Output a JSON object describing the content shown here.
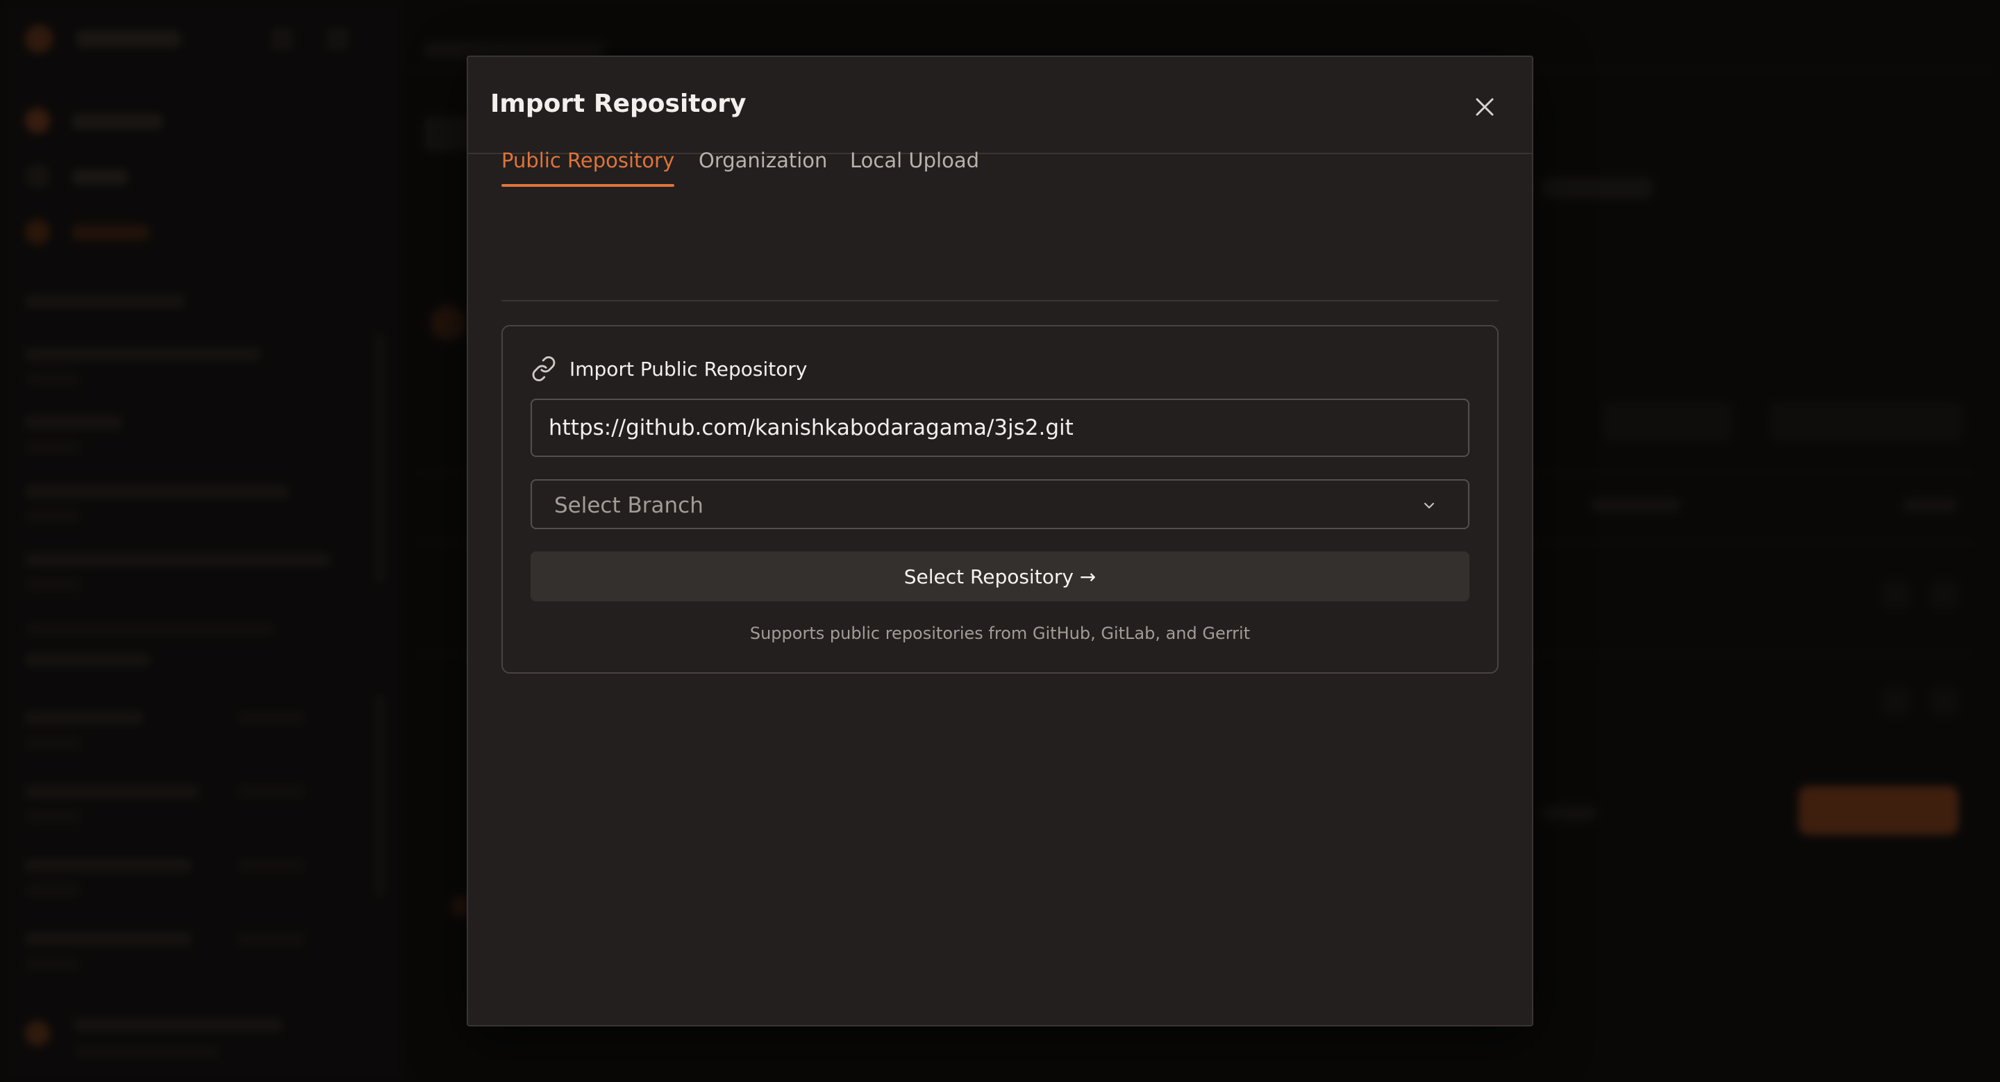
{
  "modal": {
    "title": "Import Repository",
    "close_icon": "close-icon"
  },
  "tabs": [
    {
      "label": "Public Repository",
      "active": true
    },
    {
      "label": "Organization",
      "active": false
    },
    {
      "label": "Local Upload",
      "active": false
    }
  ],
  "card": {
    "icon": "link-icon",
    "title": "Import Public Repository",
    "url_value": "https://github.com/kanishkabodaragama/3js2.git",
    "branch_placeholder": "Select Branch",
    "branch_icon": "chevron-down-icon",
    "submit_label": "Select Repository →",
    "hint": "Supports public repositories from GitHub, GitLab, and Gerrit"
  },
  "colors": {
    "accent": "#e0733a",
    "modal_bg": "#221f1e",
    "button_bg": "#33302e"
  }
}
